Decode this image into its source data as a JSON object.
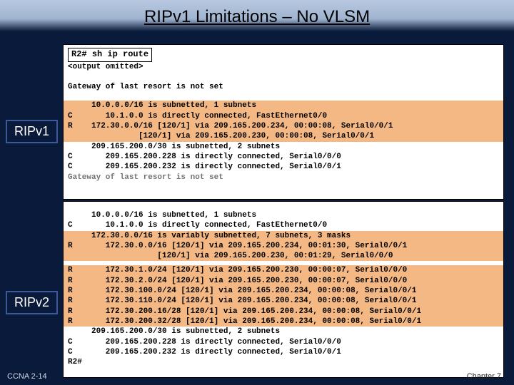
{
  "title": "RIPv1 Limitations – No VLSM",
  "badges": {
    "v1": "RIPv1",
    "v2": "RIPv2"
  },
  "footer": {
    "left": "CCNA 2-14",
    "right": "Chapter 7"
  },
  "term_v1": {
    "prompt": "R2#",
    "cmd": "sh ip route",
    "omitted": "<output omitted>",
    "gateway_blank": " ",
    "gateway": "Gateway of last resort is not set",
    "l1": "     10.0.0.0/16 is subnetted, 1 subnets",
    "l2": "C       10.1.0.0 is directly connected, FastEthernet0/0",
    "l3": "R    172.30.0.0/16 [120/1] via 209.165.200.234, 00:00:08, Serial0/0/1",
    "l4": "               [120/1] via 209.165.200.230, 00:00:08, Serial0/0/1",
    "l5": "     209.165.200.0/30 is subnetted, 2 subnets",
    "l6": "C       209.165.200.228 is directly connected, Serial0/0/0",
    "l7": "C       209.165.200.232 is directly connected, Serial0/0/1",
    "l8": "Gateway of last resort is not set"
  },
  "term_v2": {
    "l1": "     10.0.0.0/16 is subnetted, 1 subnets",
    "l2": "C       10.1.0.0 is directly connected, FastEthernet0/0",
    "l3": "     172.30.0.0/16 is variably subnetted, 7 subnets, 3 masks",
    "l4": "R       172.30.0.0/16 [120/1] via 209.165.200.234, 00:01:30, Serial0/0/1",
    "l5": "                   [120/1] via 209.165.200.230, 00:01:29, Serial0/0/0",
    "l6": "R       172.30.1.0/24 [120/1] via 209.165.200.230, 00:00:07, Serial0/0/0",
    "l7": "R       172.30.2.0/24 [120/1] via 209.165.200.230, 00:00:07, Serial0/0/0",
    "l8": "R       172.30.100.0/24 [120/1] via 209.165.200.234, 00:00:08, Serial0/0/1",
    "l9": "R       172.30.110.0/24 [120/1] via 209.165.200.234, 00:00:08, Serial0/0/1",
    "l10": "R       172.30.200.16/28 [120/1] via 209.165.200.234, 00:00:08, Serial0/0/1",
    "l11": "R       172.30.200.32/28 [120/1] via 209.165.200.234, 00:00:08, Serial0/0/1",
    "l12": "     209.165.200.0/30 is subnetted, 2 subnets",
    "l13": "C       209.165.200.228 is directly connected, Serial0/0/0",
    "l14": "C       209.165.200.232 is directly connected, Serial0/0/1",
    "l15": "R2#"
  }
}
